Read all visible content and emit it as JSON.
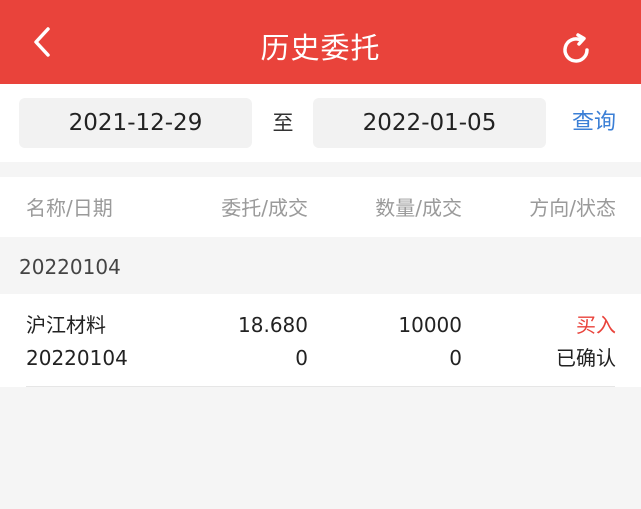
{
  "header": {
    "title": "历史委托",
    "back_icon": "chevron-left-icon",
    "refresh_icon": "refresh-icon",
    "color": "#e9433b"
  },
  "filter": {
    "start_date": "2021-12-29",
    "separator": "至",
    "end_date": "2022-01-05",
    "query_label": "查询"
  },
  "table": {
    "columns": [
      "名称/日期",
      "委托/成交",
      "数量/成交",
      "方向/状态"
    ],
    "groups": [
      {
        "date": "20220104",
        "rows": [
          {
            "name": "沪江材料",
            "date": "20220104",
            "order_price": "18.680",
            "deal_price": "0",
            "quantity": "10000",
            "deal_quantity": "0",
            "direction": "买入",
            "status": "已确认"
          }
        ]
      }
    ]
  },
  "colors": {
    "accent": "#e9433b",
    "link": "#3b7fd6",
    "buy": "#e9433b"
  }
}
